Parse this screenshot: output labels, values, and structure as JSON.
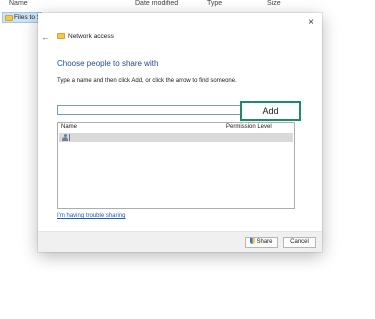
{
  "explorer": {
    "columns": [
      "Name",
      "Date modified",
      "Type",
      "Size"
    ],
    "folder_label": "Files to S"
  },
  "dialog": {
    "window_title": "Network access",
    "close_symbol": "×",
    "back_symbol": "←",
    "heading": "Choose people to share with",
    "instructions": "Type a name and then click Add, or click the arrow to find someone.",
    "name_input_value": "",
    "add_label": "Add",
    "list_headers": {
      "name": "Name",
      "permission": "Permission Level"
    },
    "trouble_link": "I'm having trouble sharing",
    "share_label": "Share",
    "cancel_label": "Cancel"
  },
  "colors": {
    "heading": "#1e4e8c",
    "link": "#1e5fb3",
    "add_border": "#1d8a6a",
    "selected_row": "#d9d9d9"
  }
}
